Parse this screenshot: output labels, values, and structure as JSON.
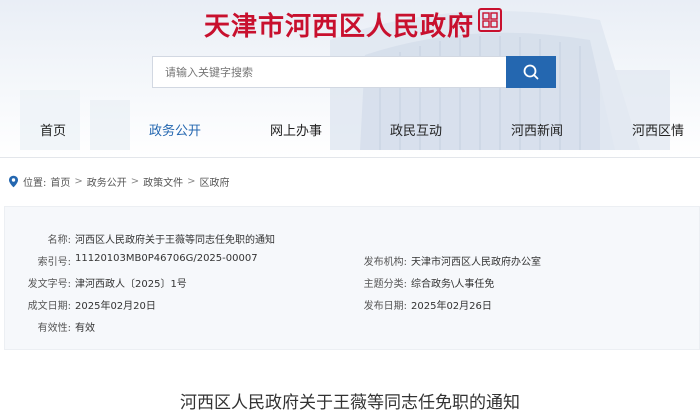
{
  "header": {
    "site_title": "天津市河西区人民政府",
    "search_placeholder": "请输入关键字搜索"
  },
  "nav": {
    "items": [
      {
        "label": "首页",
        "active": false
      },
      {
        "label": "政务公开",
        "active": true
      },
      {
        "label": "网上办事",
        "active": false
      },
      {
        "label": "政民互动",
        "active": false
      },
      {
        "label": "河西新闻",
        "active": false
      },
      {
        "label": "河西区情",
        "active": false
      }
    ]
  },
  "breadcrumb": {
    "prefix": "位置:",
    "items": [
      "首页",
      "政务公开",
      "政策文件",
      "区政府"
    ],
    "separator": ">"
  },
  "info": {
    "name_label": "名称:",
    "name_value": "河西区人民政府关于王薇等同志任免职的通知",
    "index_label": "索引号:",
    "index_value": "11120103MB0P46706G/2025-00007",
    "publisher_label": "发布机构:",
    "publisher_value": "天津市河西区人民政府办公室",
    "docno_label": "发文字号:",
    "docno_value": "津河西政人〔2025〕1号",
    "topic_label": "主题分类:",
    "topic_value": "综合政务\\人事任免",
    "created_label": "成文日期:",
    "created_value": "2025年02月20日",
    "published_label": "发布日期:",
    "published_value": "2025年02月26日",
    "validity_label": "有效性:",
    "validity_value": "有效"
  },
  "article": {
    "title": "河西区人民政府关于王薇等同志任免职的通知"
  },
  "colors": {
    "brand_red": "#c8102e",
    "accent_blue": "#2467b0"
  }
}
